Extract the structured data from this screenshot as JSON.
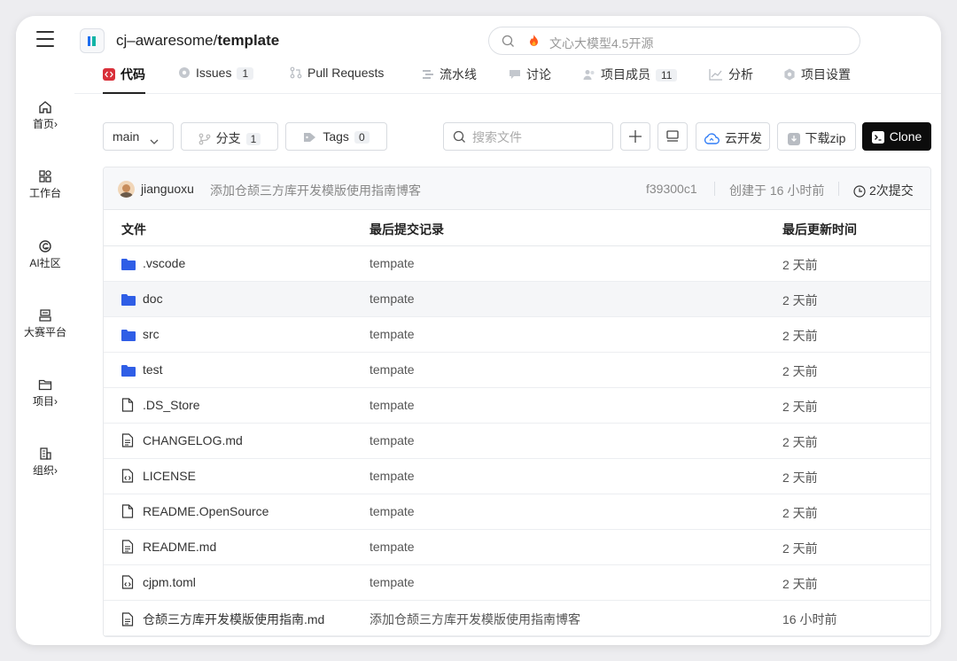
{
  "sidebar": {
    "items": [
      {
        "label": "首页",
        "icon": "home-icon"
      },
      {
        "label": "工作台",
        "icon": "grid-icon"
      },
      {
        "label": "AI社区",
        "icon": "ai-icon"
      },
      {
        "label": "大赛平台",
        "icon": "trophy-icon"
      },
      {
        "label": "项目",
        "icon": "folder-icon"
      },
      {
        "label": "组织",
        "icon": "building-icon"
      }
    ],
    "chevron": "›"
  },
  "header": {
    "repo_owner": "cj–awaresome/",
    "repo_name": "template",
    "search_placeholder": "文心大模型4.5开源"
  },
  "tabs": [
    {
      "label": "代码",
      "active": true
    },
    {
      "label": "Issues",
      "count": "1"
    },
    {
      "label": "Pull Requests"
    },
    {
      "label": "流水线"
    },
    {
      "label": "讨论"
    },
    {
      "label": "项目成员",
      "count": "11"
    },
    {
      "label": "分析"
    },
    {
      "label": "项目设置"
    }
  ],
  "toolbar": {
    "branch": "main",
    "branches_label": "分支",
    "branches_count": "1",
    "tags_label": "Tags",
    "tags_count": "0",
    "file_search_placeholder": "搜索文件",
    "cloud_dev_label": "云开发",
    "download_label": "下载zip",
    "clone_label": "Clone"
  },
  "commit": {
    "user": "jianguoxu",
    "message": "添加仓颉三方库开发模版使用指南博客",
    "hash": "f39300c1",
    "created": "创建于 16 小时前",
    "count": "2次提交"
  },
  "table": {
    "headers": [
      "文件",
      "最后提交记录",
      "最后更新时间"
    ],
    "rows": [
      {
        "name": ".vscode",
        "type": "folder",
        "commit": "tempate",
        "time": "2 天前"
      },
      {
        "name": "doc",
        "type": "folder",
        "commit": "tempate",
        "time": "2 天前"
      },
      {
        "name": "src",
        "type": "folder",
        "commit": "tempate",
        "time": "2 天前"
      },
      {
        "name": "test",
        "type": "folder",
        "commit": "tempate",
        "time": "2 天前"
      },
      {
        "name": ".DS_Store",
        "type": "file",
        "commit": "tempate",
        "time": "2 天前"
      },
      {
        "name": "CHANGELOG.md",
        "type": "markdown",
        "commit": "tempate",
        "time": "2 天前"
      },
      {
        "name": "LICENSE",
        "type": "code",
        "commit": "tempate",
        "time": "2 天前"
      },
      {
        "name": "README.OpenSource",
        "type": "file",
        "commit": "tempate",
        "time": "2 天前"
      },
      {
        "name": "README.md",
        "type": "markdown",
        "commit": "tempate",
        "time": "2 天前"
      },
      {
        "name": "cjpm.toml",
        "type": "code",
        "commit": "tempate",
        "time": "2 天前"
      },
      {
        "name": "仓颉三方库开发模版使用指南.md",
        "type": "markdown",
        "commit": "添加仓颉三方库开发模版使用指南博客",
        "time": "16 小时前"
      }
    ]
  },
  "colors": {
    "folder": "#2f5ee6",
    "accent": "#1d6df0",
    "clone_bg": "#0c0c0c",
    "code_tab_icon": "#d9303a"
  }
}
